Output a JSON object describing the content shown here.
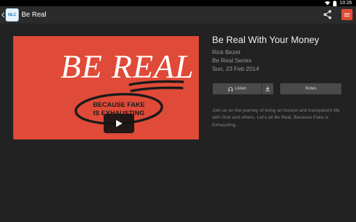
{
  "status_bar": {
    "time": "10:26",
    "icons": [
      "wifi-icon",
      "battery-icon"
    ]
  },
  "action_bar": {
    "back_icon": "chevron-left-icon",
    "app_logo_text": "NLC",
    "title": "Be Real",
    "share_icon": "share-icon",
    "brand_icon": "brand-logo-icon"
  },
  "video": {
    "art_title": "BE REAL",
    "art_tagline_line1": "BECAUSE FAKE",
    "art_tagline_line2": "IS EXHAUSTING",
    "play_icon": "play-icon",
    "colors": {
      "background": "#e04a38",
      "tag_ellipse": "#1a1a1a"
    }
  },
  "detail": {
    "title": "Be Real With Your Money",
    "speaker": "Rick Bezet",
    "series": "Be Real Series",
    "date": "Sun, 23 Feb 2014",
    "listen_label": "Listen",
    "listen_icon": "headphones-icon",
    "download_icon": "download-icon",
    "notes_label": "Notes",
    "description": "Join us on the journey of living an honest and transparent life with God and others. Let's all Be Real, Because Fake is Exhausting."
  },
  "colors": {
    "background": "#222222",
    "action_bar": "#2b2b2b",
    "button": "#4a4a4a",
    "brand": "#e14b35"
  }
}
